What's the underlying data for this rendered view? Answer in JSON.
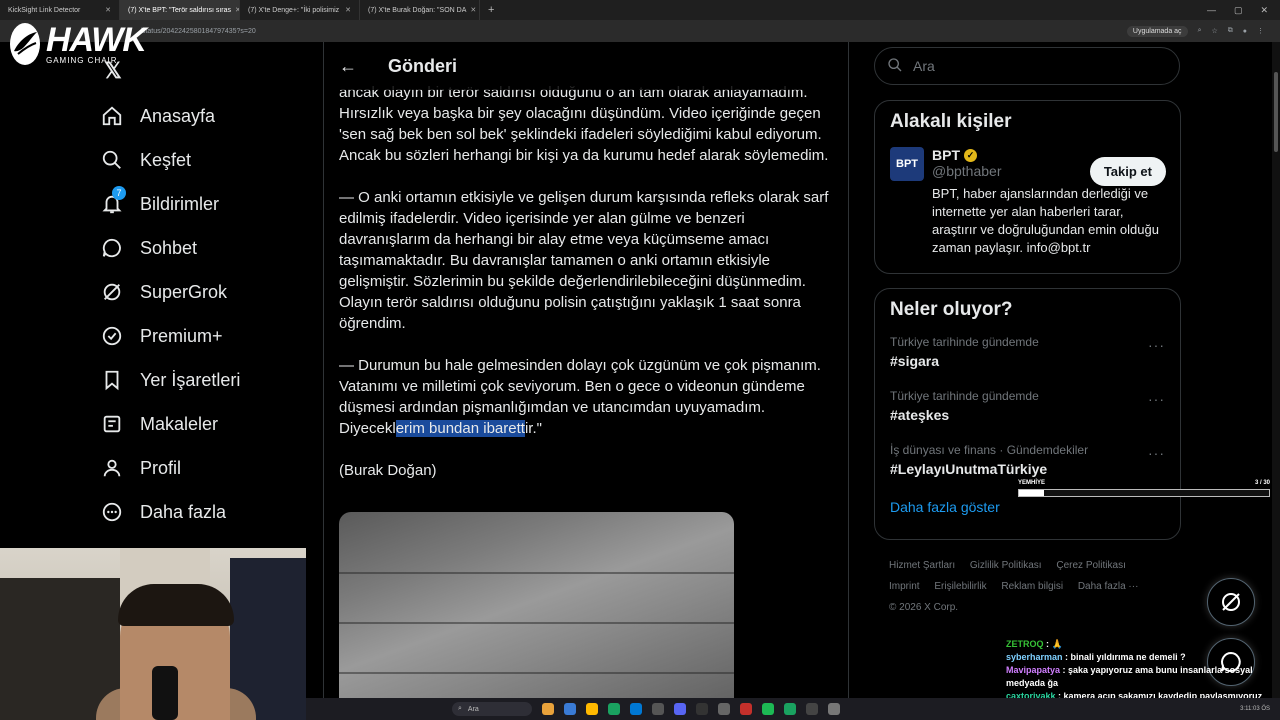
{
  "browser": {
    "tabs": [
      {
        "label": "KickSight Link Detector"
      },
      {
        "label": "(7) X'te BPT: \"Terör saldırısı sıras"
      },
      {
        "label": "(7) X'te Denge+: \"İki polisimiz"
      },
      {
        "label": "(7) X'te Burak Doğan: \"SON DA"
      }
    ],
    "url": "/status/2042242580184797435?s=20",
    "app_chip": "Uygulamada aç"
  },
  "overlay": {
    "brand_name": "HAWK",
    "brand_sub": "GAMING CHAIR",
    "progress_label": "YEMHİYE",
    "progress_count": "3 / 30",
    "progress_fraction": 0.1
  },
  "nav": {
    "items": [
      {
        "label": "Anasayfa",
        "icon": "home-icon"
      },
      {
        "label": "Keşfet",
        "icon": "search-icon"
      },
      {
        "label": "Bildirimler",
        "icon": "bell-icon",
        "badge": "7"
      },
      {
        "label": "Sohbet",
        "icon": "chat-icon"
      },
      {
        "label": "SuperGrok",
        "icon": "grok-icon"
      },
      {
        "label": "Premium+",
        "icon": "premium-icon"
      },
      {
        "label": "Yer İşaretleri",
        "icon": "bookmark-icon"
      },
      {
        "label": "Makaleler",
        "icon": "article-icon"
      },
      {
        "label": "Profil",
        "icon": "profile-icon"
      },
      {
        "label": "Daha fazla",
        "icon": "more-icon"
      }
    ]
  },
  "main": {
    "title": "Gönderi",
    "paragraphs": [
      "ancak olayın bir terör saldırısı olduğunu o an tam olarak anlayamadım. Hırsızlık veya başka bir şey olacağını düşündüm. Video içeriğinde geçen 'sen sağ bek ben sol bek' şeklindeki ifadeleri söylediğimi kabul ediyorum. Ancak bu sözleri herhangi bir kişi ya da kurumu hedef alarak söylemedim.",
      "— O anki ortamın etkisiyle ve gelişen durum karşısında refleks olarak sarf edilmiş ifadelerdir. Video içerisinde yer alan gülme ve benzeri davranışlarım da herhangi bir alay etme veya küçümseme amacı taşımamaktadır. Bu davranışlar tamamen o anki ortamın etkisiyle gelişmiştir. Sözlerimin bu şekilde değerlendirilebileceğini düşünmedim. Olayın terör saldırısı olduğunu polisin çatıştığını yaklaşık 1 saat sonra öğrendim."
    ],
    "para3_pre": "— Durumun bu hale gelmesinden dolayı çok üzgünüm ve çok pişmanım. Vatanımı ve milletimi çok seviyorum. Ben o gece o videonun gündeme düşmesi ardından pişmanlığımdan ve utancımdan uyuyamadım. Diyecekl",
    "para3_highlight": "erim bundan ibarett",
    "para3_post": "ir.\"",
    "author_line": "(Burak Doğan)"
  },
  "right": {
    "search_placeholder": "Ara",
    "related": {
      "title": "Alakalı kişiler",
      "name": "BPT",
      "handle": "@bpthaber",
      "avatar_text": "BPT",
      "follow_label": "Takip et",
      "bio": "BPT, haber ajanslarından derlediği ve internette yer alan haberleri tarar, araştırır ve doğruluğundan emin olduğu zaman paylaşır. info@bpt.tr"
    },
    "trends": {
      "title": "Neler oluyor?",
      "items": [
        {
          "category": "Türkiye tarihinde gündemde",
          "name": "#sigara"
        },
        {
          "category": "Türkiye tarihinde gündemde",
          "name": "#ateşkes"
        },
        {
          "category": "İş dünyası ve finans · Gündemdekiler",
          "name": "#LeylayıUnutmaTürkiye"
        }
      ],
      "show_more": "Daha fazla göster"
    },
    "footer": [
      "Hizmet Şartları",
      "Gizlilik Politikası",
      "Çerez Politikası",
      "Imprint",
      "Erişilebilirlik",
      "Reklam bilgisi",
      "Daha fazla ···",
      "© 2026 X Corp."
    ]
  },
  "chat": [
    {
      "user": "ZETROQ",
      "msg": "🙏"
    },
    {
      "user": "syberharman",
      "msg": "binali yıldırıma ne demeli ?"
    },
    {
      "user": "Mavipapatya",
      "msg": "şaka yapıyoruz ama bunu insanlarla sosyal medyada ğa"
    },
    {
      "user": "caxtorivakk",
      "msg": "kamera açıp şakamızı kaydedip paylaşmıyoruz"
    }
  ],
  "taskbar": {
    "search": "Ara",
    "time": "3:11:03 ÖS"
  },
  "colors": {
    "accent": "#1d9bf0",
    "background": "#000000",
    "border": "#2f3336",
    "muted": "#71767b"
  }
}
